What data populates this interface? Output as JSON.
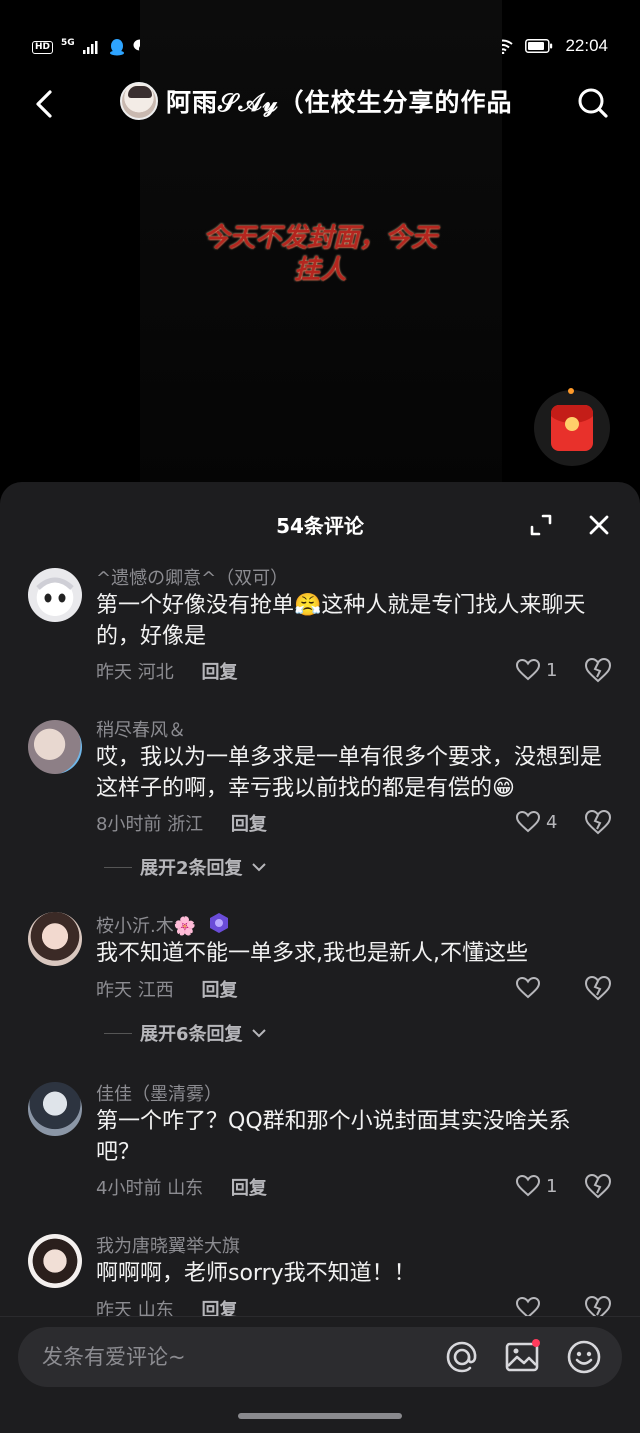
{
  "status_bar": {
    "hd": "HD",
    "network": "5G",
    "time": "22:04",
    "icons": [
      "signal-icon",
      "qq-icon",
      "wechat-icon",
      "location-icon",
      "location-icon",
      "moon-icon",
      "wifi-icon",
      "battery-icon"
    ]
  },
  "header": {
    "title": "阿雨𝒮𝒜𝓎（住校生分享的作品",
    "back_icon": "chevron-left-icon",
    "search_icon": "search-icon"
  },
  "video": {
    "caption_line1": "今天不发封面，今天",
    "caption_line2": "挂人"
  },
  "comments_panel": {
    "title": "54条评论",
    "comments": [
      {
        "name": "^遗憾の卿意^（双可）",
        "text": "第一个好像没有抢单😤这种人就是专门找人来聊天的，好像是",
        "time": "昨天",
        "location": "河北",
        "reply_label": "回复",
        "likes": "1"
      },
      {
        "name": "稍尽春风＆",
        "text": "哎，我以为一单多求是一单有很多个要求，没想到是这样子的啊，幸亏我以前找的都是有偿的😁",
        "time": "8小时前",
        "location": "浙江",
        "reply_label": "回复",
        "likes": "4",
        "expand_label": "展开2条回复"
      },
      {
        "name": "桉小沂.木🌸",
        "text": "我不知道不能一单多求,我也是新人,不懂这些",
        "time": "昨天",
        "location": "江西",
        "reply_label": "回复",
        "likes": "",
        "expand_label": "展开6条回复"
      },
      {
        "name": "佳佳（墨清雾）",
        "text": "第一个咋了？QQ群和那个小说封面其实没啥关系吧？",
        "time": "4小时前",
        "location": "山东",
        "reply_label": "回复",
        "likes": "1"
      },
      {
        "name": "我为唐晓翼举大旗",
        "text": "啊啊啊，老师sorry我不知道！！",
        "time": "昨天",
        "location": "山东",
        "reply_label": "回复",
        "likes": ""
      }
    ]
  },
  "input_bar": {
    "placeholder": "发条有爱评论~",
    "icons": [
      "at-icon",
      "image-icon",
      "emoji-icon"
    ]
  },
  "colors": {
    "panel_bg": "#1d1d1f",
    "caption_red": "#b4261f",
    "muted_text": "#8c8c91"
  }
}
